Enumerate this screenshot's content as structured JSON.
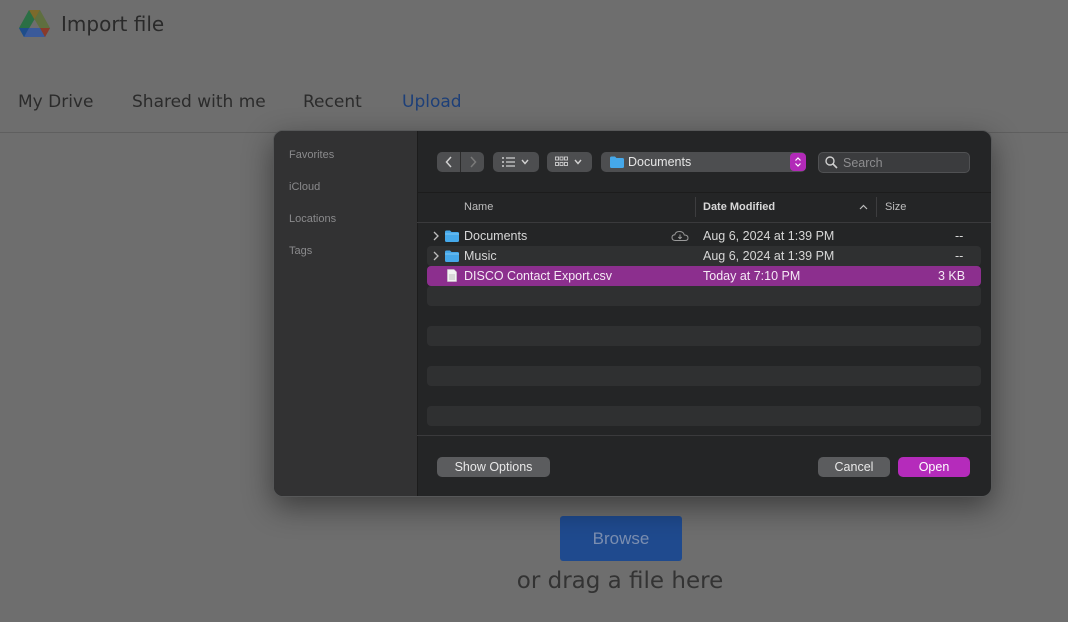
{
  "page": {
    "title": "Import file",
    "tabs": [
      "My Drive",
      "Shared with me",
      "Recent",
      "Upload"
    ],
    "active_tab": "Upload",
    "browse_label": "Browse",
    "drag_text": "or drag a file here"
  },
  "dialog": {
    "sidebar": {
      "sections": [
        "Favorites",
        "iCloud",
        "Locations",
        "Tags"
      ]
    },
    "toolbar": {
      "back_icon": "chevron-left-icon",
      "forward_icon": "chevron-right-icon",
      "list_view_icon": "list-view-icon",
      "grid_view_icon": "grid-view-icon",
      "location": "Documents",
      "search_placeholder": "Search"
    },
    "columns": {
      "name": "Name",
      "date": "Date Modified",
      "size": "Size"
    },
    "files": [
      {
        "name": "Documents",
        "kind": "folder",
        "date": "Aug 6, 2024 at 1:39 PM",
        "size": "--",
        "icloud": true,
        "expandable": true,
        "selected": false
      },
      {
        "name": "Music",
        "kind": "folder",
        "date": "Aug 6, 2024 at 1:39 PM",
        "size": "--",
        "icloud": false,
        "expandable": true,
        "selected": false
      },
      {
        "name": "DISCO Contact Export.csv",
        "kind": "file",
        "date": "Today at 7:10 PM",
        "size": "3 KB",
        "icloud": false,
        "expandable": false,
        "selected": true
      }
    ],
    "buttons": {
      "options": "Show Options",
      "cancel": "Cancel",
      "open": "Open"
    }
  },
  "colors": {
    "accent": "#b52bbb",
    "selection": "#8c2f8e",
    "folder": "#45a8ea",
    "drive_blue": "#1f4a8e",
    "active_tab": "#1d3f78"
  }
}
